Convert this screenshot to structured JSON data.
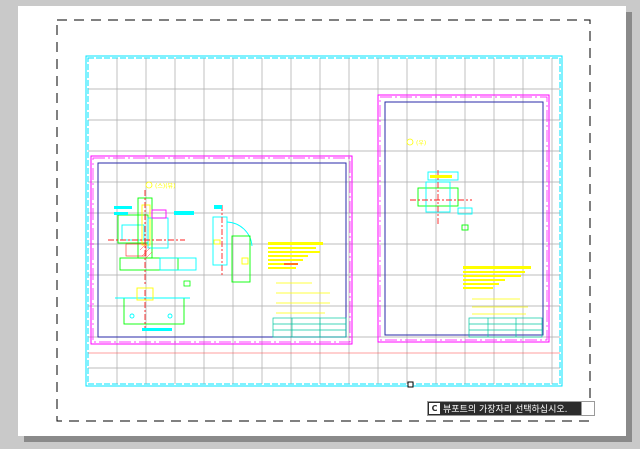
{
  "prompt": {
    "icon": "command-icon",
    "icon_glyph": "C",
    "text": "뷰포트의 가장자리 선택하십시오."
  },
  "drawing": {
    "left_view_label": "① 스(뷰포트)",
    "right_view_label": "② 우(뷰)",
    "colors": {
      "paper": "#ffffff",
      "background": "#c9c9c9",
      "viewport_border": "#00e5ff",
      "title_frame": "#ff00ff",
      "sheet_frame": "#2a2aa8",
      "grid": "#9a9a9a",
      "annotation": "#ffff00"
    }
  }
}
